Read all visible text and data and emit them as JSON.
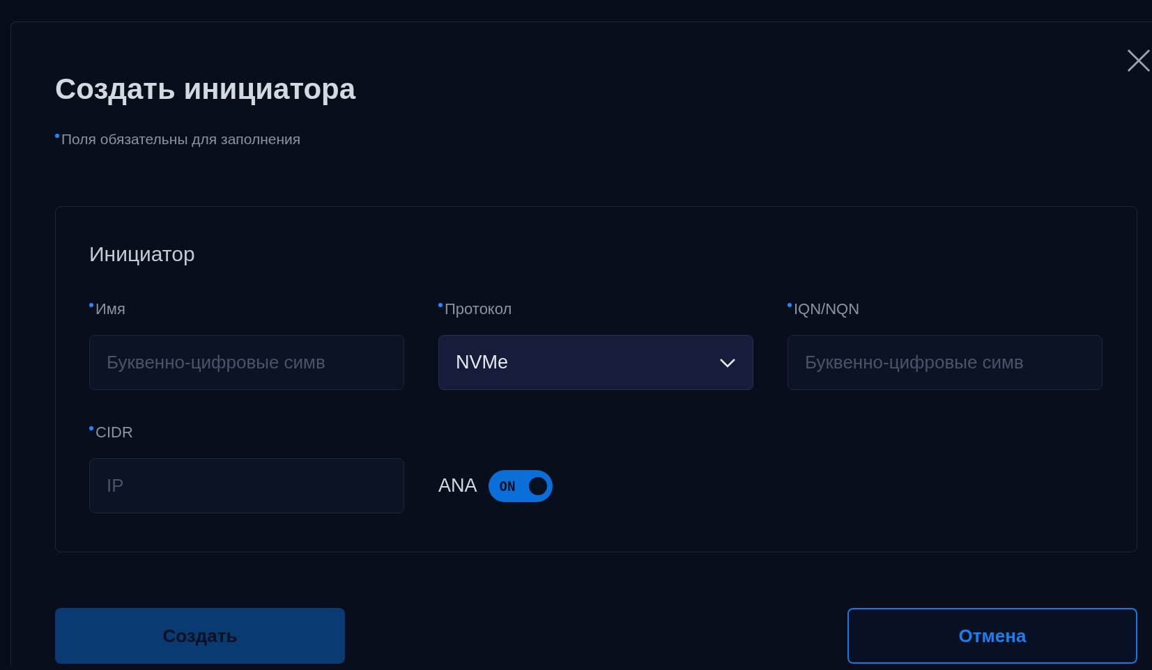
{
  "dialog": {
    "title": "Создать инициатора",
    "required_note": "Поля обязательны для заполнения"
  },
  "section": {
    "title": "Инициатор",
    "fields": [
      {
        "kind": "input",
        "label": "Имя",
        "required": true,
        "placeholder": "Буквенно-цифровые симв"
      },
      {
        "kind": "select",
        "label": "Протокол",
        "required": true,
        "value": "NVMe"
      },
      {
        "kind": "input",
        "label": "IQN/NQN",
        "required": true,
        "placeholder": "Буквенно-цифровые симв"
      },
      {
        "kind": "input",
        "label": "CIDR",
        "required": true,
        "placeholder": "IP"
      },
      {
        "kind": "toggle",
        "label": "ANA",
        "on": true,
        "state_text": "ON"
      }
    ]
  },
  "buttons": [
    {
      "kind": "primary",
      "label": "Создать",
      "disabled": true
    },
    {
      "kind": "secondary",
      "label": "Отмена",
      "disabled": false
    }
  ]
}
